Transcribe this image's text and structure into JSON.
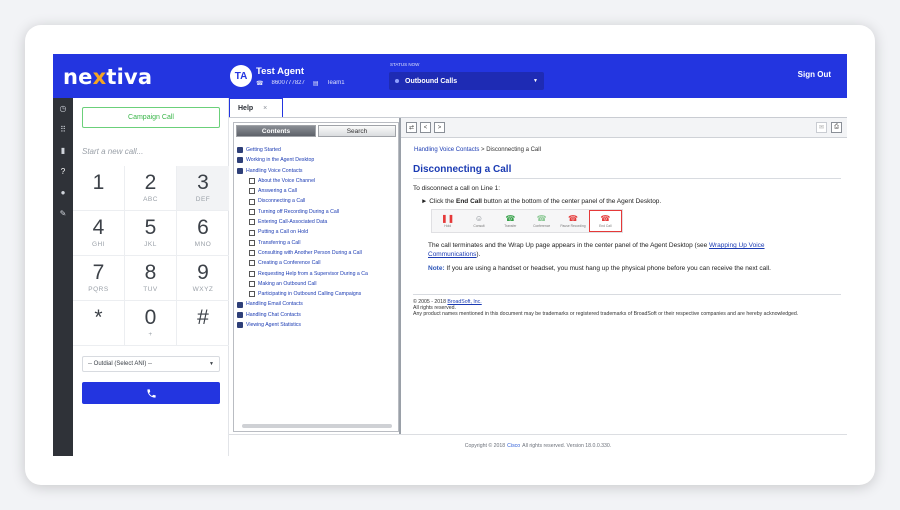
{
  "header": {
    "logo": "nextiva",
    "avatar_initials": "TA",
    "agent_name": "Test Agent",
    "agent_phone": "8600777827",
    "agent_team": "Team1",
    "status_label": "STATUS NOW",
    "status_value": "Outbound Calls",
    "sign_out": "Sign Out"
  },
  "rail": {
    "icons": [
      "history-icon",
      "keypad-icon",
      "stats-icon",
      "help-icon",
      "user-icon",
      "tools-icon"
    ],
    "active": "help-icon"
  },
  "dialer": {
    "campaign_button": "Campaign Call",
    "input_placeholder": "Start a new call...",
    "keys": [
      {
        "n": "1",
        "l": ""
      },
      {
        "n": "2",
        "l": "ABC"
      },
      {
        "n": "3",
        "l": "DEF"
      },
      {
        "n": "4",
        "l": "GHI"
      },
      {
        "n": "5",
        "l": "JKL"
      },
      {
        "n": "6",
        "l": "MNO"
      },
      {
        "n": "7",
        "l": "PQRS"
      },
      {
        "n": "8",
        "l": "TUV"
      },
      {
        "n": "9",
        "l": "WXYZ"
      },
      {
        "n": "*",
        "l": ""
      },
      {
        "n": "0",
        "l": "+"
      },
      {
        "n": "#",
        "l": ""
      }
    ],
    "outdial_select": "-- Outdial (Select ANI) --"
  },
  "help": {
    "tab_label": "Help",
    "tab_close": "×",
    "tree_tabs": {
      "contents": "Contents",
      "search": "Search"
    },
    "tree": [
      {
        "label": "Getting Started",
        "level": 0,
        "icon": "book"
      },
      {
        "label": "Working in the Agent Desktop",
        "level": 0,
        "icon": "book"
      },
      {
        "label": "Handling Voice Contacts",
        "level": 0,
        "icon": "open"
      },
      {
        "label": "About the Voice Channel",
        "level": 1,
        "icon": "page"
      },
      {
        "label": "Answering a Call",
        "level": 1,
        "icon": "page"
      },
      {
        "label": "Disconnecting a Call",
        "level": 1,
        "icon": "page"
      },
      {
        "label": "Turning off Recording During a Call",
        "level": 1,
        "icon": "page"
      },
      {
        "label": "Entering Call-Associated Data",
        "level": 1,
        "icon": "page"
      },
      {
        "label": "Putting a Call on Hold",
        "level": 1,
        "icon": "page"
      },
      {
        "label": "Transferring a Call",
        "level": 1,
        "icon": "page"
      },
      {
        "label": "Consulting with Another Person During a Call",
        "level": 1,
        "icon": "page"
      },
      {
        "label": "Creating a Conference Call",
        "level": 1,
        "icon": "page"
      },
      {
        "label": "Requesting Help from a Supervisor During a Ca",
        "level": 1,
        "icon": "page"
      },
      {
        "label": "Making an Outbound Call",
        "level": 1,
        "icon": "page"
      },
      {
        "label": "Participating in Outbound Calling Campaigns",
        "level": 1,
        "icon": "page"
      },
      {
        "label": "Handling Email Contacts",
        "level": 0,
        "icon": "book"
      },
      {
        "label": "Handling Chat Contacts",
        "level": 0,
        "icon": "book"
      },
      {
        "label": "Viewing Agent Statistics",
        "level": 0,
        "icon": "book"
      }
    ],
    "toolbar": {
      "sync": "⇄",
      "back": "<",
      "forward": ">"
    },
    "breadcrumb_link": "Handling Voice Contacts",
    "breadcrumb_current": " > Disconnecting a Call",
    "title": "Disconnecting a Call",
    "intro": "To disconnect a call on Line 1:",
    "step_pre": "Click the ",
    "step_bold": "End Call",
    "step_post": " button at the bottom of the center panel of the Agent Desktop.",
    "call_buttons": [
      {
        "label": "Hold",
        "glyph": "❚❚",
        "color": "#e53939"
      },
      {
        "label": "Consult",
        "glyph": "☺",
        "color": "#7a8088"
      },
      {
        "label": "Transfer",
        "glyph": "☎",
        "color": "#37a24a"
      },
      {
        "label": "Conference",
        "glyph": "☎",
        "color": "#8cc995"
      },
      {
        "label": "Pause Recording",
        "glyph": "☎",
        "color": "#e53939"
      },
      {
        "label": "End Call",
        "glyph": "☎",
        "color": "#e53939"
      }
    ],
    "para2_pre": "The call terminates and the Wrap Up page appears in the center panel of the Agent Desktop (see ",
    "para2_link": "Wrapping Up Voice Communications",
    "para2_post": ").",
    "note_label": "Note:",
    "note_text": " If you are using a handset or headset, you must hang up the physical phone before you can receive the next call.",
    "footer_line1_pre": "© 2005 - 2018 ",
    "footer_line1_link": "BroadSoft, Inc.",
    "footer_line2": "All rights reserved.",
    "footer_line3": "Any product names mentioned in this document may be trademarks or registered trademarks of BroadSoft or their respective companies and are hereby acknowledged."
  },
  "app_footer": {
    "pre": "Copyright © 2018",
    "link": "Cisco",
    "post": "All rights reserved. Version 18.0.0.330."
  },
  "colors": {
    "brand": "#2335e0",
    "accent_orange": "#f5a623",
    "link": "#1b3bb3",
    "campaign_green": "#3ab64a"
  }
}
